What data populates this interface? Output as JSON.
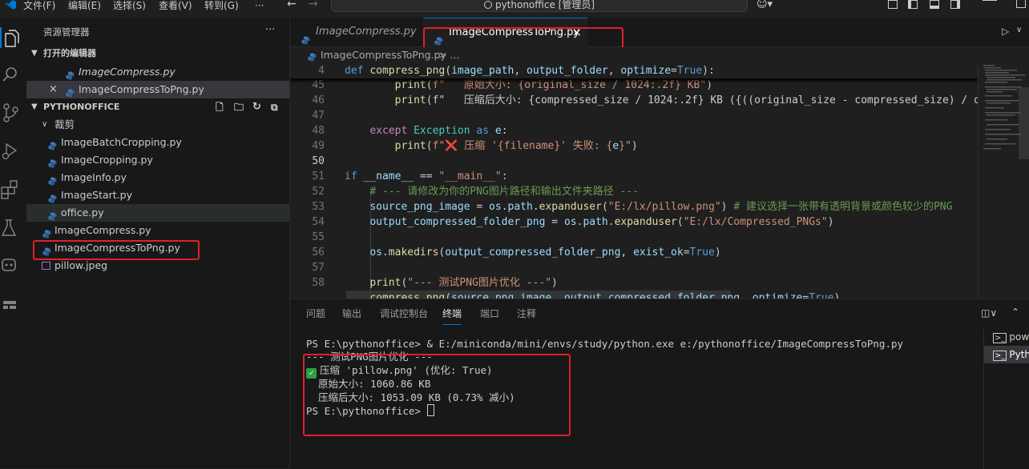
{
  "title_bar": {
    "menus": [
      "文件(F)",
      "编辑(E)",
      "选择(S)",
      "查看(V)",
      "转到(G)",
      "···"
    ],
    "search_text": "pythonoffice [管理员]"
  },
  "sidebar": {
    "title": "资源管理器",
    "more": "···",
    "open_editors_header": "打开的编辑器",
    "open_editors": [
      {
        "label": "ImageCompress.py"
      },
      {
        "label": "ImageCompressToPng.py",
        "close": "×"
      }
    ],
    "project_header": "PYTHONOFFICE",
    "folder_label": "裁剪",
    "folder_files": [
      "ImageBatchCropping.py",
      "ImageCropping.py",
      "ImageInfo.py",
      "ImageStart.py",
      "office.py"
    ],
    "root_files": [
      "ImageCompress.py",
      "ImageCompressToPng.py",
      "pillow.jpeg"
    ]
  },
  "editor": {
    "tabs": [
      {
        "label": "ImageCompress.py",
        "active": false
      },
      {
        "label": "ImageCompressToPng.py",
        "active": true,
        "close": "×"
      }
    ],
    "breadcrumb_file": "ImageCompressToPng.py",
    "breadcrumb_rest": " > ...",
    "sticky_line_number": "4",
    "line_numbers": [
      "",
      "45",
      "46",
      "47",
      "48",
      "49",
      "50",
      "51",
      "52",
      "53",
      "54",
      "55",
      "56",
      "57",
      "58"
    ],
    "code_lines": [
      "def compress_png(image_path, output_folder, optimize=True):",
      "        print(f\"   原始大小: {original_size / 1024:.2f} KB\")",
      "        print(f\"   压缩后大小: {compressed_size / 1024:.2f} KB ({((original_size - compressed_size) / or",
      "",
      "    except Exception as e:",
      "        print(f\"❌ 压缩 '{filename}' 失败: {e}\")",
      "",
      "if __name__ == \"__main__\":",
      "    # --- 请修改为你的PNG图片路径和输出文件夹路径 ---",
      "    source_png_image = os.path.expanduser(\"E:/lx/pillow.png\") # 建议选择一张带有透明背景或颜色较少的PNG",
      "    output_compressed_folder_png = os.path.expanduser(\"E:/lx/Compressed_PNGs\")",
      "",
      "    os.makedirs(output_compressed_folder_png, exist_ok=True)",
      "",
      "    print(\"--- 测试PNG图片优化 ---\")",
      "    compress_png(source_png_image, output_compressed_folder_png, optimize=True)"
    ]
  },
  "panel": {
    "tabs": [
      "问题",
      "输出",
      "调试控制台",
      "终端",
      "端口",
      "注释"
    ],
    "active_tab": "终端",
    "terminal_lines": [
      "PS E:\\pythonoffice> & E:/miniconda/mini/envs/study/python.exe e:/pythonoffice/ImageCompressToPng.py",
      "--- 测试PNG图片优化 ---",
      "压缩 'pillow.png' (优化: True)",
      "  原始大小: 1060.86 KB",
      "  压缩后大小: 1053.09 KB (0.73% 减小)",
      "PS E:\\pythonoffice> "
    ],
    "terminal_list": [
      "powe",
      "Pyth"
    ]
  },
  "colors": {
    "accent": "#0078d4",
    "highlight_box": "#e0202a",
    "python_icon": "#3e7ab8",
    "check": "#2ea043"
  }
}
